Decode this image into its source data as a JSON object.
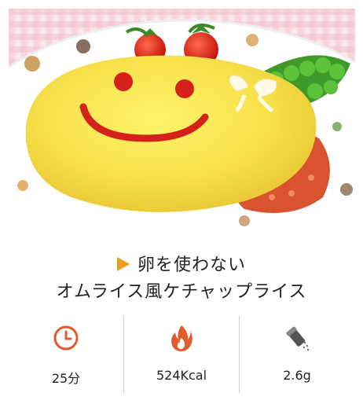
{
  "recipe": {
    "title_line1": "卵を使わない",
    "title_line2": "オムライス風ケチャップライス"
  },
  "stats": {
    "time": {
      "value": "25分",
      "icon": "clock-icon"
    },
    "calories": {
      "value": "524Kcal",
      "icon": "flame-icon"
    },
    "salt": {
      "value": "2.6g",
      "icon": "salt-shaker-icon"
    }
  },
  "colors": {
    "accent": "#f29a1c",
    "icon_red": "#e35b2a",
    "divider": "#cfcfcf"
  }
}
